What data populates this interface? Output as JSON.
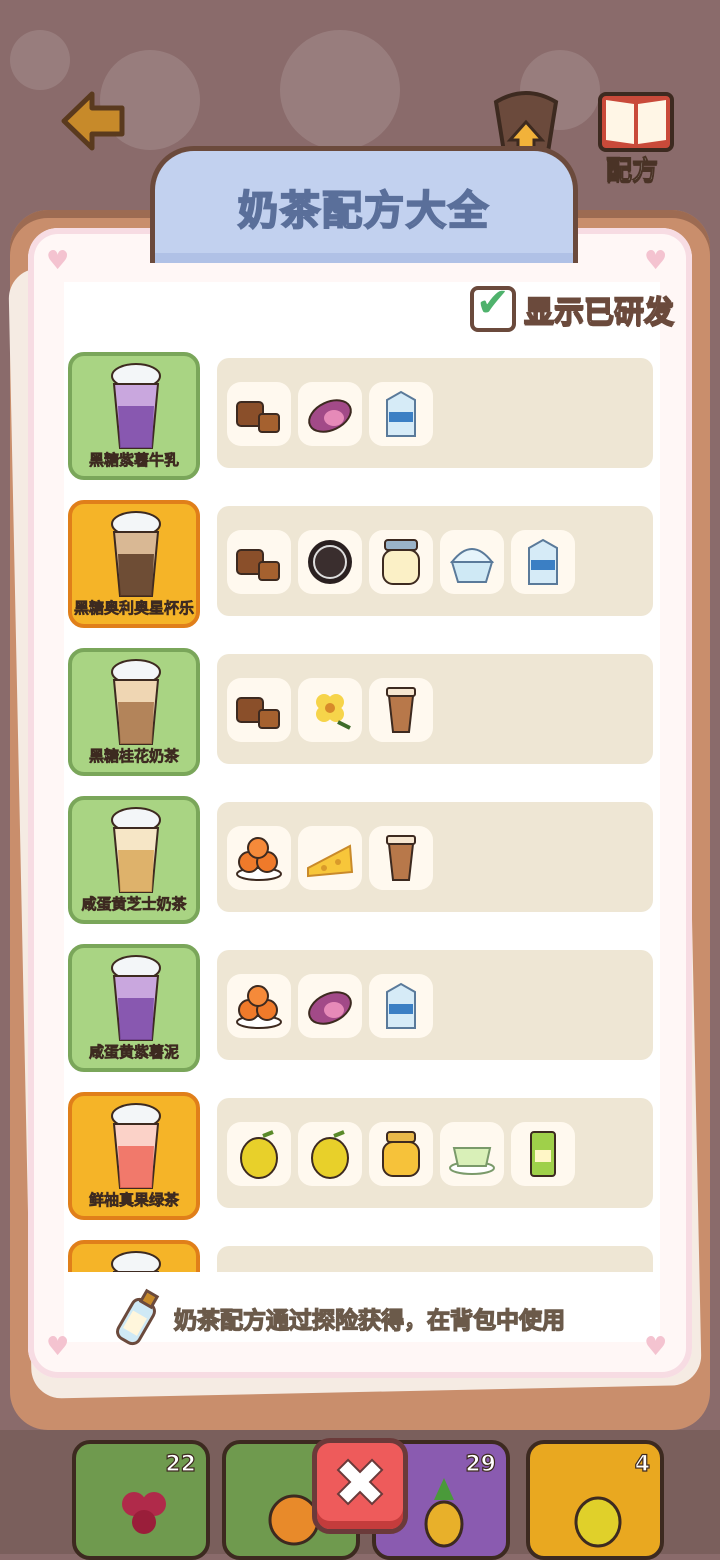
{
  "header": {
    "panel_title": "奶茶配方大全",
    "top_buttons": [
      {
        "label": "升级",
        "icon": "cup-upgrade-icon"
      },
      {
        "label": "配方",
        "icon": "recipe-book-icon"
      }
    ]
  },
  "filter": {
    "label": "显示已研发",
    "checked": true
  },
  "recipes": [
    {
      "name": "黑糖紫薯牛乳",
      "card": "green",
      "cup": "purple",
      "ingredients": [
        "brown-sugar-icon",
        "sweet-potato-icon",
        "milk-carton-icon"
      ]
    },
    {
      "name": "黑糖奥利奥星杯乐",
      "card": "gold",
      "cup": "brown",
      "ingredients": [
        "brown-sugar-icon",
        "oreo-icon",
        "condensed-milk-icon",
        "whipped-cream-icon",
        "milk-carton-icon"
      ]
    },
    {
      "name": "黑糖桂花奶茶",
      "card": "green",
      "cup": "tan",
      "ingredients": [
        "brown-sugar-icon",
        "osmanthus-icon",
        "milk-tea-cup-icon"
      ]
    },
    {
      "name": "咸蛋黄芝士奶茶",
      "card": "green",
      "cup": "cream",
      "ingredients": [
        "salted-egg-yolk-icon",
        "cheese-icon",
        "milk-tea-cup-icon"
      ]
    },
    {
      "name": "咸蛋黄紫薯泥",
      "card": "green",
      "cup": "purple",
      "ingredients": [
        "salted-egg-yolk-icon",
        "sweet-potato-icon",
        "milk-carton-icon"
      ]
    },
    {
      "name": "鲜柚真果绿茶",
      "card": "gold",
      "cup": "pink",
      "ingredients": [
        "grapefruit-icon",
        "grapefruit-icon",
        "honey-jar-icon",
        "green-tea-icon",
        "syrup-bottle-icon"
      ]
    },
    {
      "name": "",
      "card": "gold",
      "cup": "pink",
      "ingredients": []
    }
  ],
  "hint": {
    "text": "奶茶配方通过探险获得，在背包中使用"
  },
  "bottom_slots": [
    {
      "icon": "grape-icon",
      "count": "22",
      "color": "#6f9a4e"
    },
    {
      "icon": "orange-icon",
      "count": "",
      "color": "#6f9a4e"
    },
    {
      "icon": "pineapple-icon",
      "count": "29",
      "color": "#8a5bb0"
    },
    {
      "icon": "pear-icon",
      "count": "4",
      "color": "#e9a820"
    }
  ],
  "close_label": "✖",
  "colors": {
    "accent_green": "#a9d483",
    "accent_gold": "#f5b428",
    "panel": "#c98e6c",
    "title_tab": "#c2d1ef"
  }
}
